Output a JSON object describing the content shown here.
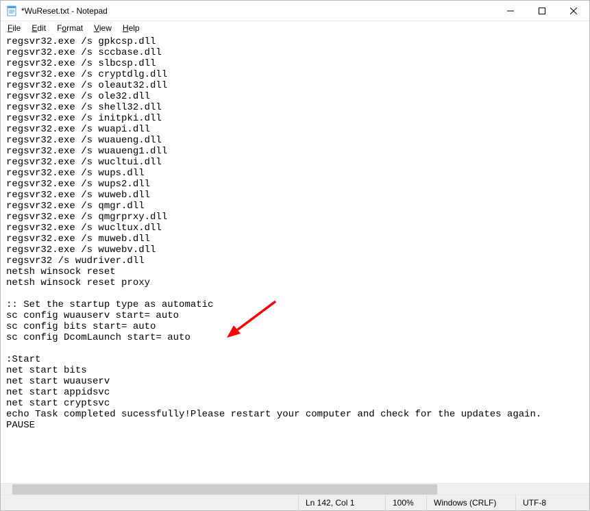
{
  "window": {
    "title": "*WuReset.txt - Notepad"
  },
  "menus": {
    "file": "File",
    "edit": "Edit",
    "format": "Format",
    "view": "View",
    "help": "Help"
  },
  "editor": {
    "text": "regsvr32.exe /s gpkcsp.dll\nregsvr32.exe /s sccbase.dll\nregsvr32.exe /s slbcsp.dll\nregsvr32.exe /s cryptdlg.dll\nregsvr32.exe /s oleaut32.dll\nregsvr32.exe /s ole32.dll\nregsvr32.exe /s shell32.dll\nregsvr32.exe /s initpki.dll\nregsvr32.exe /s wuapi.dll\nregsvr32.exe /s wuaueng.dll\nregsvr32.exe /s wuaueng1.dll\nregsvr32.exe /s wucltui.dll\nregsvr32.exe /s wups.dll\nregsvr32.exe /s wups2.dll\nregsvr32.exe /s wuweb.dll\nregsvr32.exe /s qmgr.dll\nregsvr32.exe /s qmgrprxy.dll\nregsvr32.exe /s wucltux.dll\nregsvr32.exe /s muweb.dll\nregsvr32.exe /s wuwebv.dll\nregsvr32 /s wudriver.dll\nnetsh winsock reset\nnetsh winsock reset proxy\n\n:: Set the startup type as automatic\nsc config wuauserv start= auto\nsc config bits start= auto\nsc config DcomLaunch start= auto\n\n:Start\nnet start bits\nnet start wuauserv\nnet start appidsvc\nnet start cryptsvc\necho Task completed sucessfully!Please restart your computer and check for the updates again.\nPAUSE"
  },
  "status": {
    "position": "Ln 142, Col 1",
    "zoom": "100%",
    "eol": "Windows (CRLF)",
    "encoding": "UTF-8"
  },
  "annotation": {
    "arrow_color": "#ff0000"
  }
}
